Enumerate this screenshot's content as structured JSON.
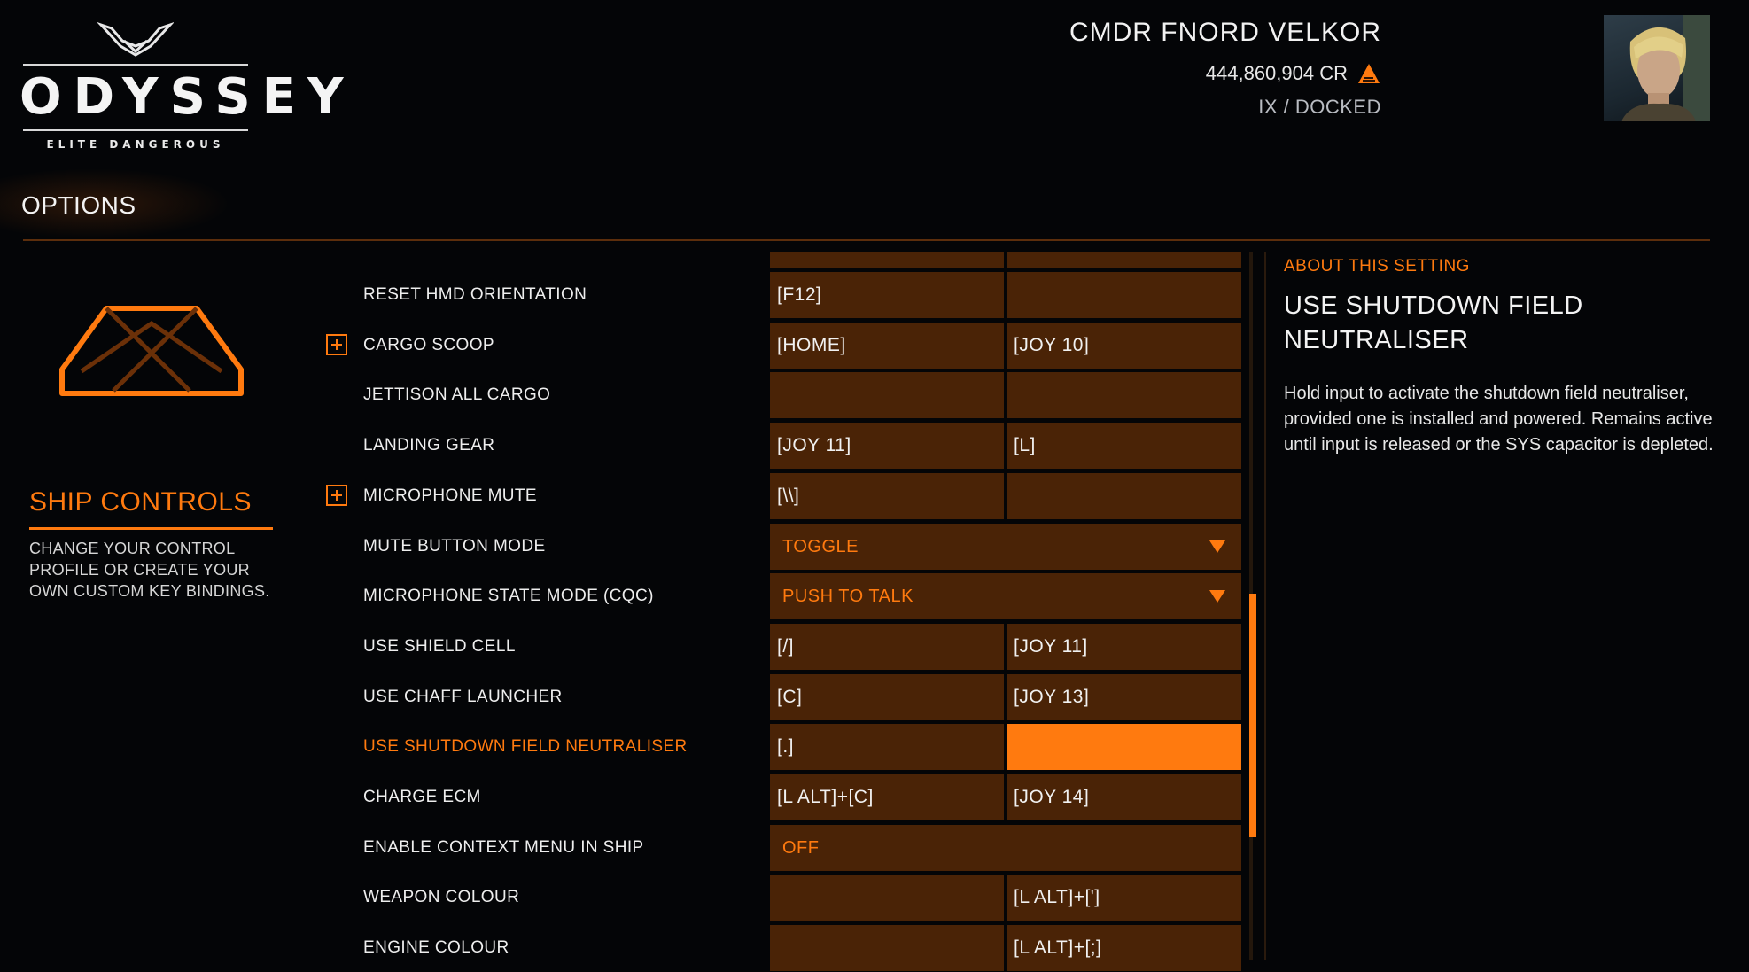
{
  "logo": {
    "title": "ODYSSEY",
    "subtitle": "ELITE DANGEROUS"
  },
  "commander": {
    "name": "CMDR FNORD VELKOR",
    "credits": "444,860,904 CR",
    "status": "IX / DOCKED"
  },
  "options": {
    "title": "OPTIONS"
  },
  "category": {
    "title": "SHIP CONTROLS",
    "description": "CHANGE YOUR CONTROL PROFILE OR CREATE YOUR OWN CUSTOM KEY BINDINGS."
  },
  "bindings": [
    {
      "label": "RESET HMD ORIENTATION",
      "primary": "[F12]",
      "secondary": ""
    },
    {
      "label": "CARGO SCOOP",
      "expandable": true,
      "primary": "[HOME]",
      "secondary": "[JOY 10]"
    },
    {
      "label": "JETTISON ALL CARGO",
      "primary": "",
      "secondary": ""
    },
    {
      "label": "LANDING GEAR",
      "primary": "[JOY 11]",
      "secondary": "[L]"
    },
    {
      "label": "MICROPHONE MUTE",
      "expandable": true,
      "primary": "[\\\\]",
      "secondary": ""
    },
    {
      "label": "MUTE BUTTON MODE",
      "select": "TOGGLE"
    },
    {
      "label": "MICROPHONE STATE MODE (CQC)",
      "select": "PUSH TO TALK"
    },
    {
      "label": "USE SHIELD CELL",
      "primary": "[/]",
      "secondary": "[JOY 11]"
    },
    {
      "label": "USE CHAFF LAUNCHER",
      "primary": "[C]",
      "secondary": "[JOY 13]"
    },
    {
      "label": "USE SHUTDOWN FIELD NEUTRALISER",
      "selected": true,
      "primary": "[.]",
      "secondary": ""
    },
    {
      "label": "CHARGE ECM",
      "primary": "[L ALT]+[C]",
      "secondary": "[JOY 14]"
    },
    {
      "label": "ENABLE CONTEXT MENU IN SHIP",
      "toggle": "OFF"
    },
    {
      "label": "WEAPON COLOUR",
      "primary": "",
      "secondary": "[L ALT]+[']"
    },
    {
      "label": "ENGINE COLOUR",
      "primary": "",
      "secondary": "[L ALT]+[;]"
    }
  ],
  "about": {
    "heading": "ABOUT THIS SETTING",
    "title": "USE SHUTDOWN FIELD NEUTRALISER",
    "body": "Hold input to activate the shutdown field neutraliser, provided one is installed and powered. Remains active until input is released or the SYS capacitor is depleted."
  },
  "icons": {
    "credits": "elite-rank-icon",
    "category": "ship-icon",
    "expand": "plus-icon",
    "dropdown": "dropdown-arrow-icon"
  },
  "colors": {
    "accent": "#ff7a0f",
    "cell": "#4a2306",
    "background": "#040507"
  }
}
